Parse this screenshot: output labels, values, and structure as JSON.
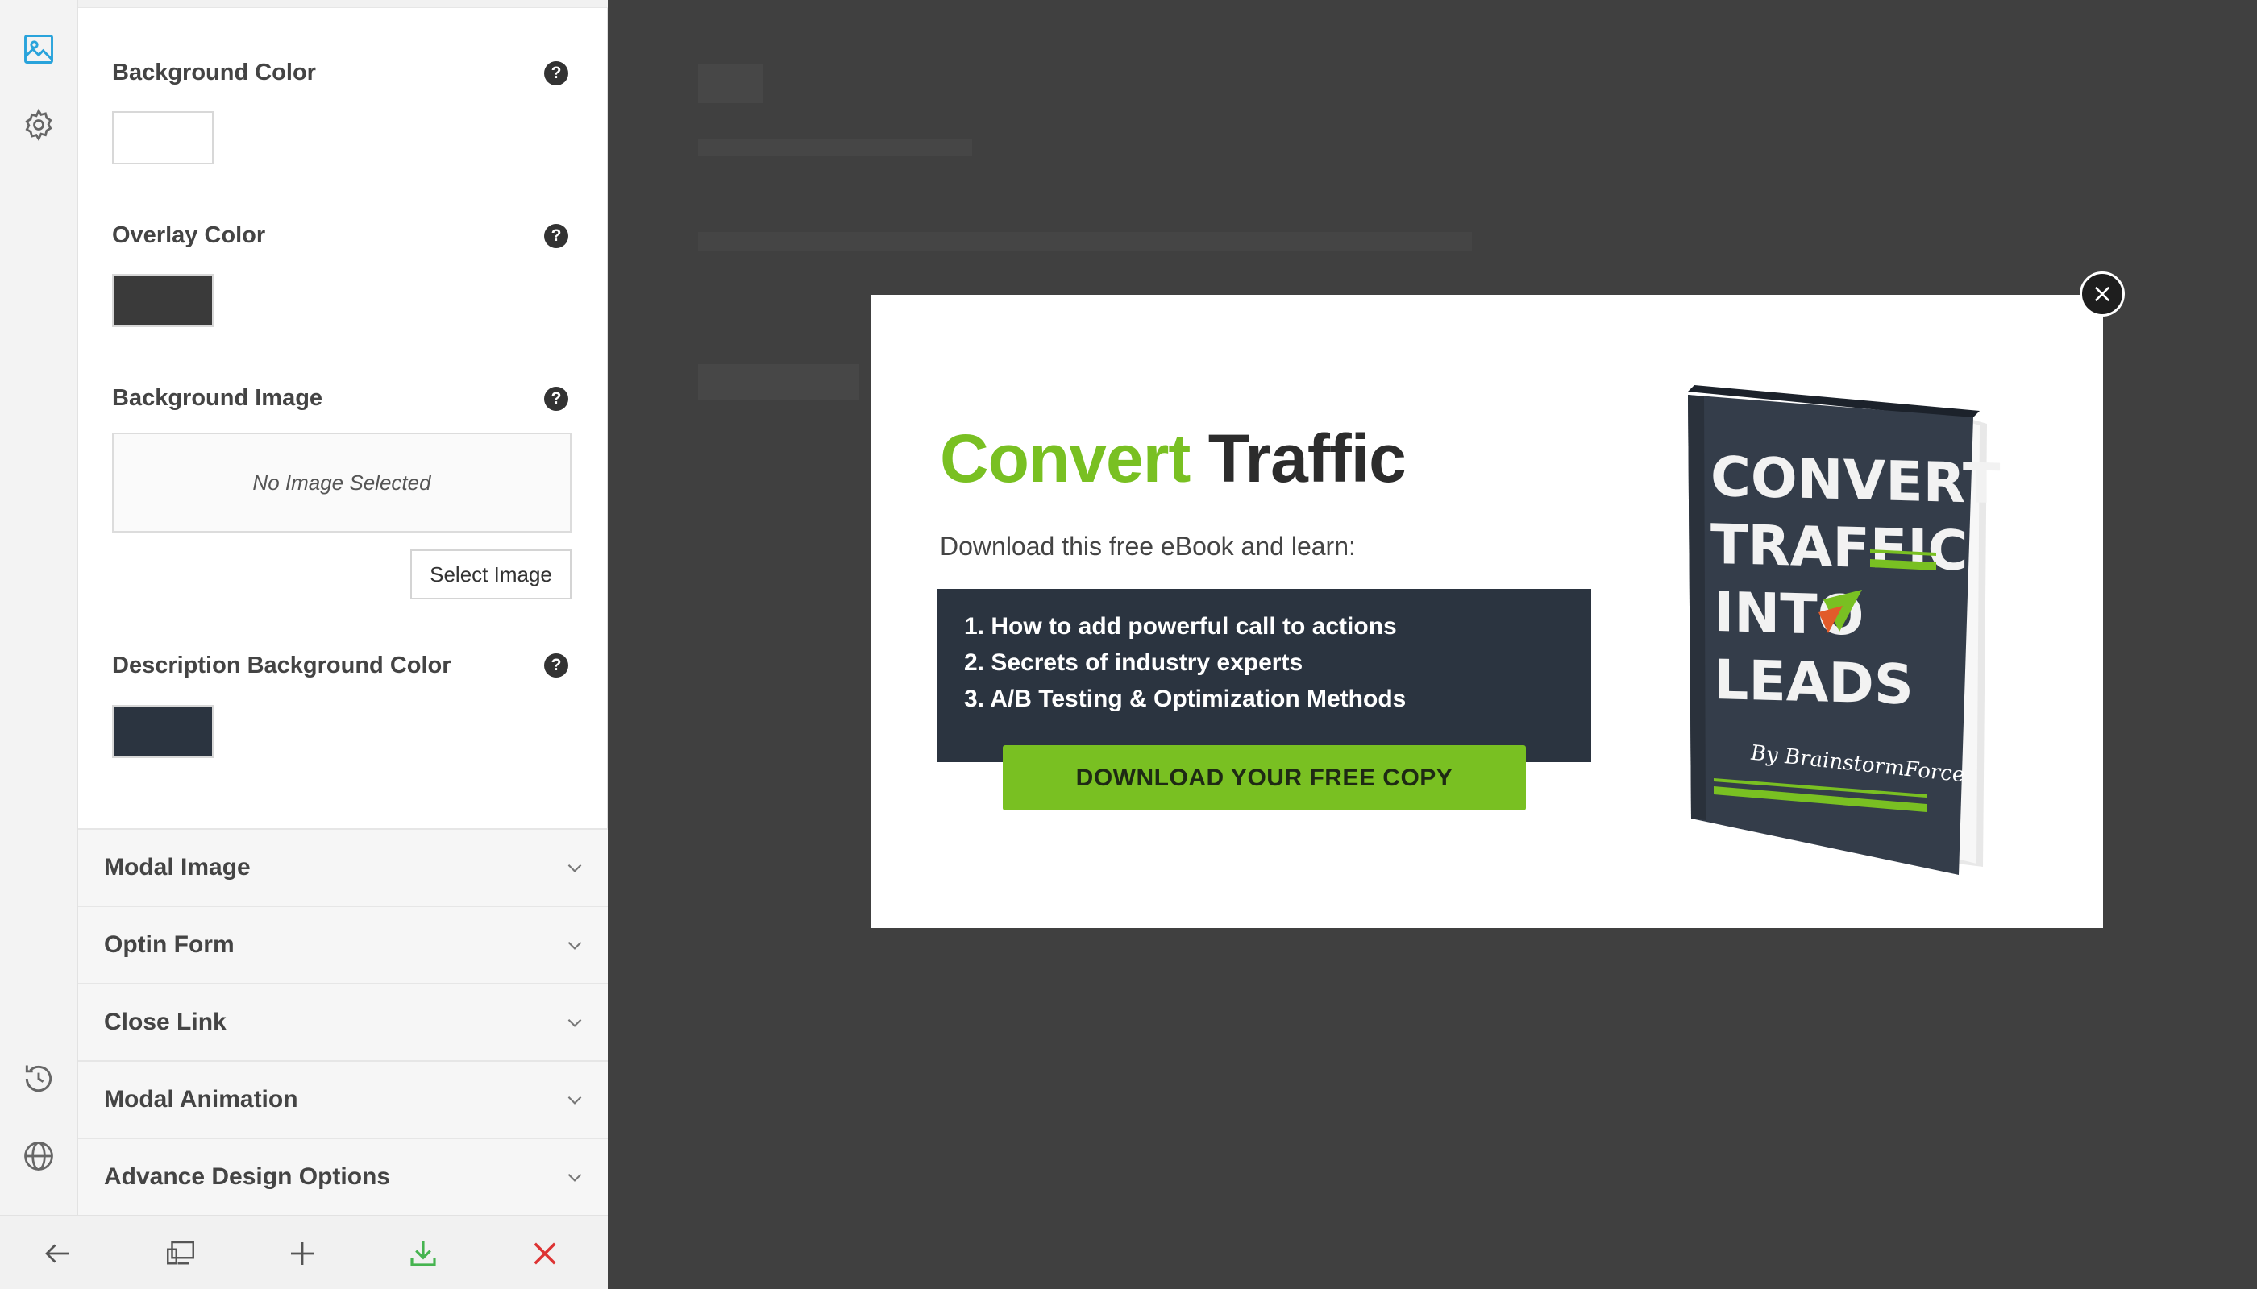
{
  "rail": {
    "top_icons": [
      "image-icon",
      "gear-icon"
    ],
    "bottom_icons": [
      "history-icon",
      "globe-icon"
    ]
  },
  "panel": {
    "background_color": {
      "label": "Background Color",
      "value": "#ffffff"
    },
    "overlay_color": {
      "label": "Overlay Color",
      "value": "#3a3a3a"
    },
    "background_image": {
      "label": "Background Image",
      "empty_text": "No Image Selected",
      "button": "Select Image"
    },
    "description_bg_color": {
      "label": "Description Background Color",
      "value": "#2b3440"
    },
    "help_glyph": "?",
    "sections": [
      {
        "label": "Modal Image"
      },
      {
        "label": "Optin Form"
      },
      {
        "label": "Close Link"
      },
      {
        "label": "Modal Animation"
      },
      {
        "label": "Advance Design Options"
      }
    ]
  },
  "toolbar": {
    "buttons": [
      "back-arrow-icon",
      "devices-icon",
      "plus-icon",
      "download-icon",
      "close-icon"
    ],
    "colors": {
      "default": "#555555",
      "save": "#46b450",
      "close": "#dd3333"
    }
  },
  "modal": {
    "headline_accent": "Convert",
    "headline_rest": "Traffic",
    "subhead": "Download this free eBook and learn:",
    "items": [
      "1. How to add powerful call to actions",
      "2. Secrets of industry experts",
      "3. A/B Testing & Optimization Methods"
    ],
    "cta": "DOWNLOAD YOUR FREE COPY",
    "book": {
      "lines": [
        "CONVERT",
        "TRAFFIC",
        "INTO",
        "LEADS"
      ],
      "byline": "By BrainstormForce"
    },
    "colors": {
      "accent": "#79c022",
      "desc_bg": "#2b3440"
    }
  }
}
